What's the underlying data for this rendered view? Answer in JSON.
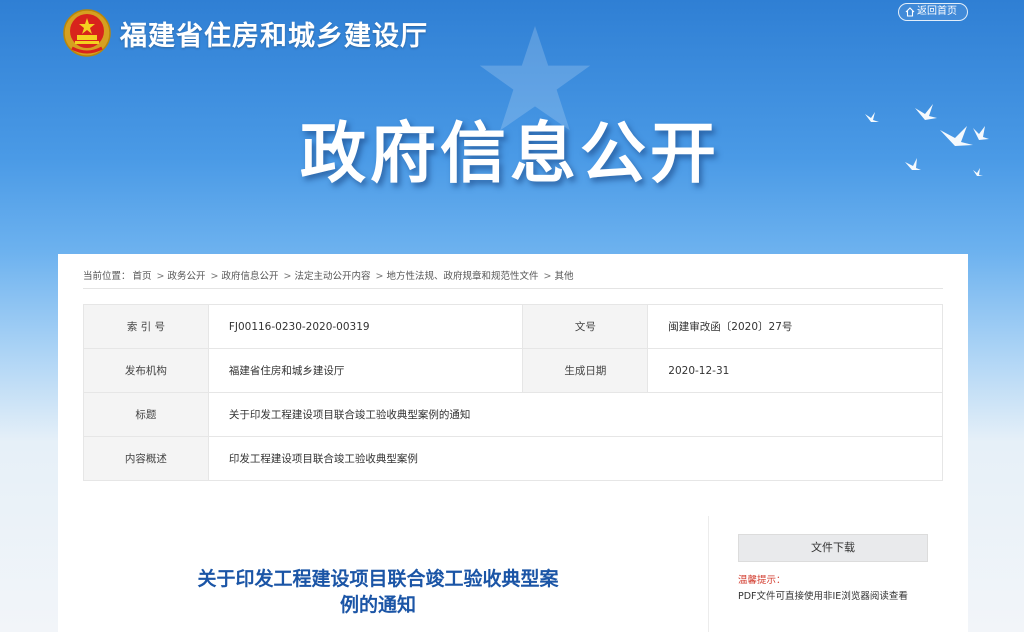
{
  "header": {
    "site_title": "福建省住房和城乡建设厅",
    "back_label": "返回首页",
    "banner_title": "政府信息公开"
  },
  "breadcrumb": {
    "prefix": "当前位置：",
    "items": [
      "首页",
      "政务公开",
      "政府信息公开",
      "法定主动公开内容",
      "地方性法规、政府规章和规范性文件",
      "其他"
    ],
    "separator": ">"
  },
  "info": {
    "index_label": "索 引 号",
    "index_value": "FJ00116-0230-2020-00319",
    "docno_label": "文号",
    "docno_value": "闽建审改函〔2020〕27号",
    "publisher_label": "发布机构",
    "publisher_value": "福建省住房和城乡建设厅",
    "date_label": "生成日期",
    "date_value": "2020-12-31",
    "title_label": "标题",
    "title_value": "关于印发工程建设项目联合竣工验收典型案例的通知",
    "summary_label": "内容概述",
    "summary_value": "印发工程建设项目联合竣工验收典型案例"
  },
  "document": {
    "title_line1": "关于印发工程建设项目联合竣工验收典型案",
    "title_line2": "例的通知"
  },
  "sidebar": {
    "download_label": "文件下载",
    "tip_title": "温馨提示：",
    "tip_text": "PDF文件可直接使用非IE浏览器阅读查看"
  },
  "colors": {
    "accent_blue": "#1b55a6",
    "tip_red": "#d23a2c",
    "sky_top": "#2f7fd4"
  }
}
